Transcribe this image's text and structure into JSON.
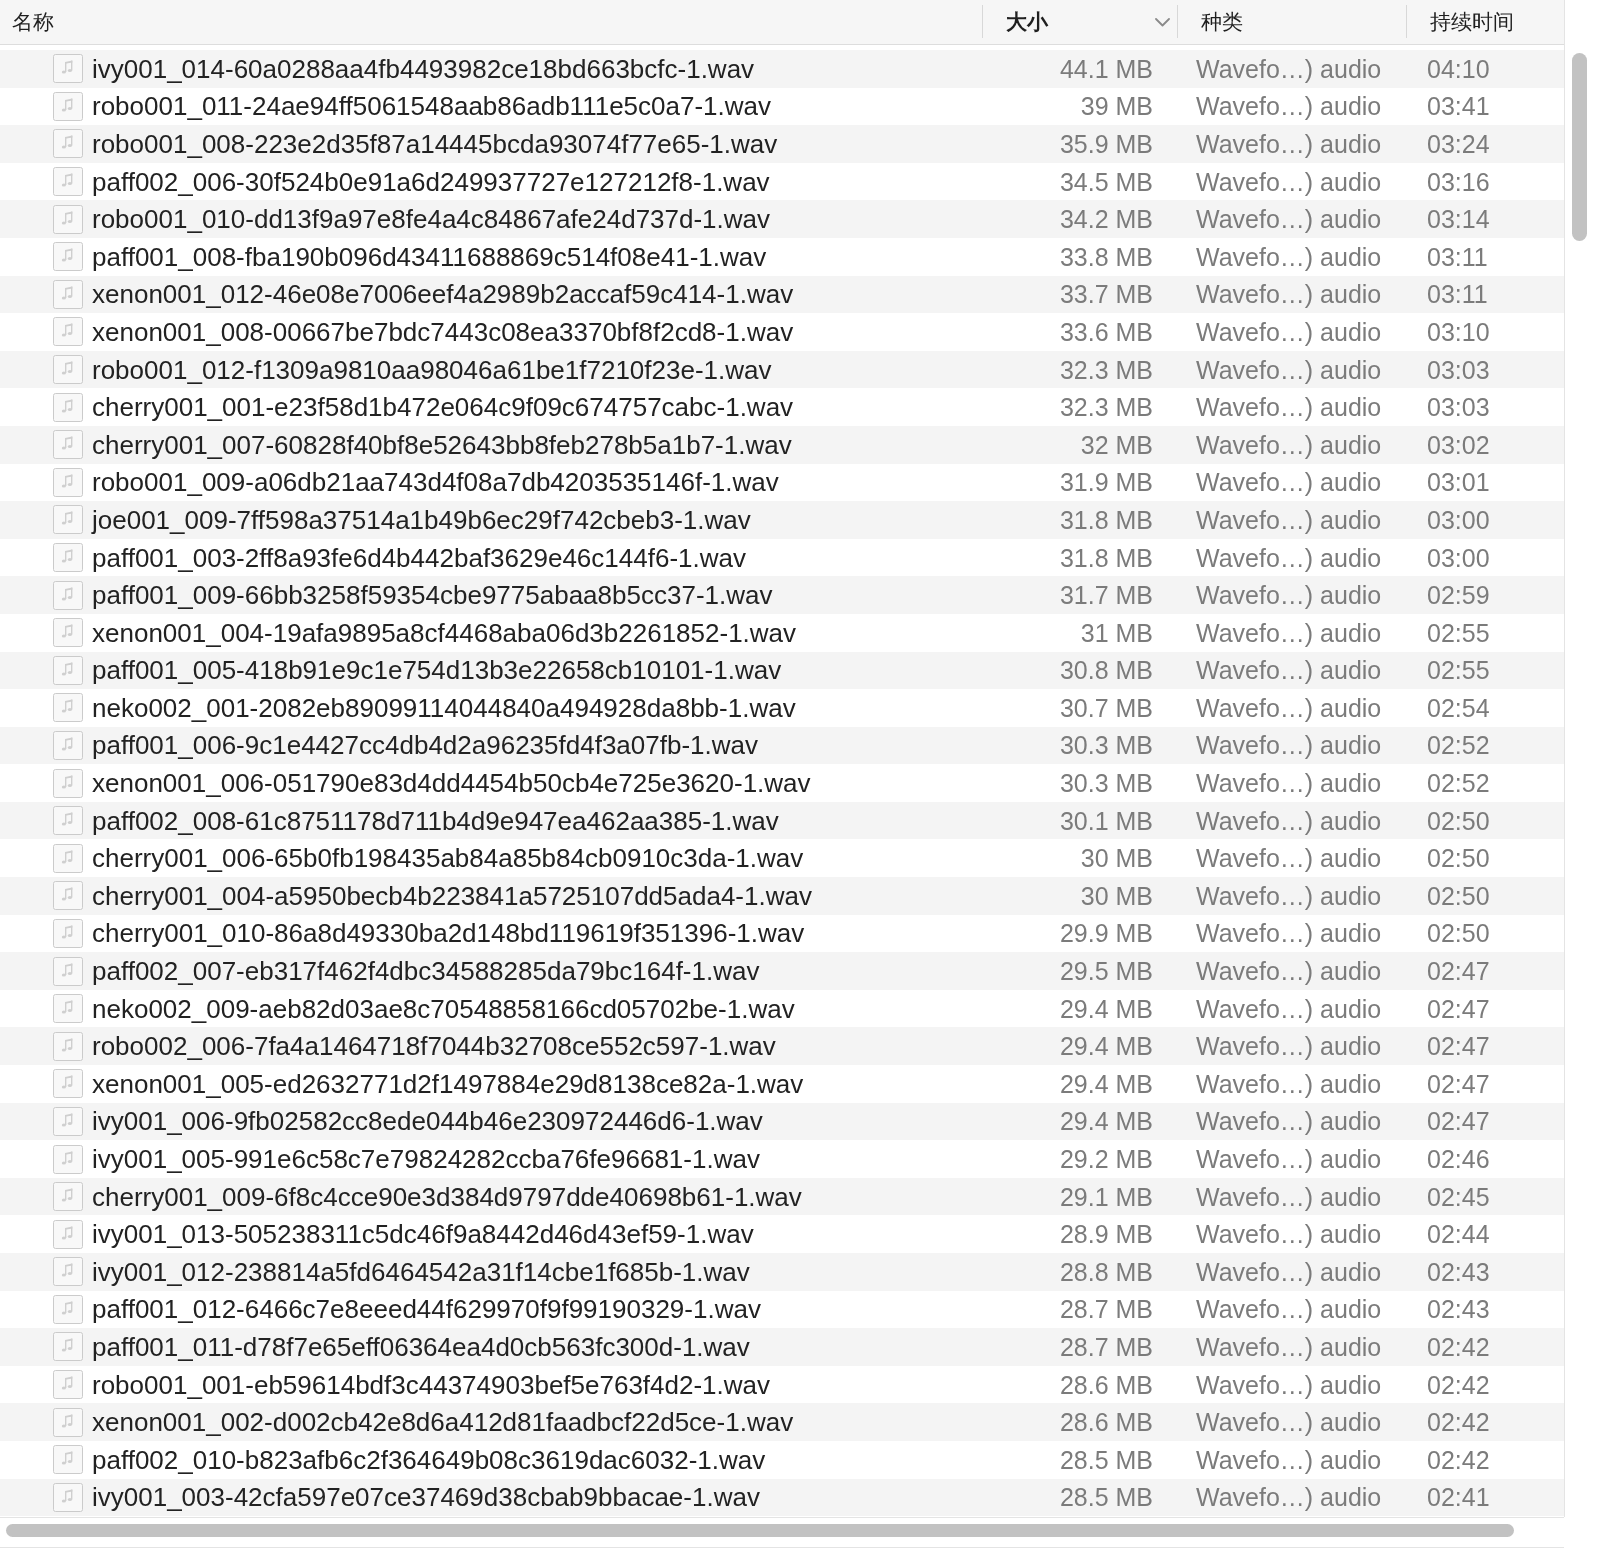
{
  "columns": [
    {
      "label": "名称",
      "sorted": false
    },
    {
      "label": "大小",
      "sorted": true
    },
    {
      "label": "种类",
      "sorted": false
    },
    {
      "label": "持续时间",
      "sorted": false
    }
  ],
  "rows": [
    {
      "name": "ivy001_014-60a0288aa4fb4493982ce18bd663bcfc-1.wav",
      "size": "44.1 MB",
      "file_kind": "Wavefo…) audio",
      "duration": "04:10",
      "selected": false
    },
    {
      "name": "robo001_011-24ae94ff5061548aab86adb111e5c0a7-1.wav",
      "size": "39 MB",
      "file_kind": "Wavefo…) audio",
      "duration": "03:41",
      "selected": false
    },
    {
      "name": "robo001_008-223e2d35f87a14445bcda93074f77e65-1.wav",
      "size": "35.9 MB",
      "file_kind": "Wavefo…) audio",
      "duration": "03:24",
      "selected": false
    },
    {
      "name": "paff002_006-30f524b0e91a6d249937727e127212f8-1.wav",
      "size": "34.5 MB",
      "file_kind": "Wavefo…) audio",
      "duration": "03:16",
      "selected": false
    },
    {
      "name": "robo001_010-dd13f9a97e8fe4a4c84867afe24d737d-1.wav",
      "size": "34.2 MB",
      "file_kind": "Wavefo…) audio",
      "duration": "03:14",
      "selected": false
    },
    {
      "name": "paff001_008-fba190b096d43411688869c514f08e41-1.wav",
      "size": "33.8 MB",
      "file_kind": "Wavefo…) audio",
      "duration": "03:11",
      "selected": false
    },
    {
      "name": "xenon001_012-46e08e7006eef4a2989b2accaf59c414-1.wav",
      "size": "33.7 MB",
      "file_kind": "Wavefo…) audio",
      "duration": "03:11",
      "selected": false
    },
    {
      "name": "xenon001_008-00667be7bdc7443c08ea3370bf8f2cd8-1.wav",
      "size": "33.6 MB",
      "file_kind": "Wavefo…) audio",
      "duration": "03:10",
      "selected": false
    },
    {
      "name": "robo001_012-f1309a9810aa98046a61be1f7210f23e-1.wav",
      "size": "32.3 MB",
      "file_kind": "Wavefo…) audio",
      "duration": "03:03",
      "selected": false
    },
    {
      "name": "cherry001_001-e23f58d1b472e064c9f09c674757cabc-1.wav",
      "size": "32.3 MB",
      "file_kind": "Wavefo…) audio",
      "duration": "03:03",
      "selected": false
    },
    {
      "name": "cherry001_007-60828f40bf8e52643bb8feb278b5a1b7-1.wav",
      "size": "32 MB",
      "file_kind": "Wavefo…) audio",
      "duration": "03:02",
      "selected": false
    },
    {
      "name": "robo001_009-a06db21aa743d4f08a7db4203535146f-1.wav",
      "size": "31.9 MB",
      "file_kind": "Wavefo…) audio",
      "duration": "03:01",
      "selected": false
    },
    {
      "name": "joe001_009-7ff598a37514a1b49b6ec29f742cbeb3-1.wav",
      "size": "31.8 MB",
      "file_kind": "Wavefo…) audio",
      "duration": "03:00",
      "selected": false
    },
    {
      "name": "paff001_003-2ff8a93fe6d4b442baf3629e46c144f6-1.wav",
      "size": "31.8 MB",
      "file_kind": "Wavefo…) audio",
      "duration": "03:00",
      "selected": false
    },
    {
      "name": "paff001_009-66bb3258f59354cbe9775abaa8b5cc37-1.wav",
      "size": "31.7 MB",
      "file_kind": "Wavefo…) audio",
      "duration": "02:59",
      "selected": false
    },
    {
      "name": "xenon001_004-19afa9895a8cf4468aba06d3b2261852-1.wav",
      "size": "31 MB",
      "file_kind": "Wavefo…) audio",
      "duration": "02:55",
      "selected": false
    },
    {
      "name": "paff001_005-418b91e9c1e754d13b3e22658cb10101-1.wav",
      "size": "30.8 MB",
      "file_kind": "Wavefo…) audio",
      "duration": "02:55",
      "selected": false
    },
    {
      "name": "neko002_001-2082eb89099114044840a494928da8bb-1.wav",
      "size": "30.7 MB",
      "file_kind": "Wavefo…) audio",
      "duration": "02:54",
      "selected": false
    },
    {
      "name": "paff001_006-9c1e4427cc4db4d2a96235fd4f3a07fb-1.wav",
      "size": "30.3 MB",
      "file_kind": "Wavefo…) audio",
      "duration": "02:52",
      "selected": false
    },
    {
      "name": "xenon001_006-051790e83d4dd4454b50cb4e725e3620-1.wav",
      "size": "30.3 MB",
      "file_kind": "Wavefo…) audio",
      "duration": "02:52",
      "selected": false
    },
    {
      "name": "paff002_008-61c8751178d711b4d9e947ea462aa385-1.wav",
      "size": "30.1 MB",
      "file_kind": "Wavefo…) audio",
      "duration": "02:50",
      "selected": false
    },
    {
      "name": "cherry001_006-65b0fb198435ab84a85b84cb0910c3da-1.wav",
      "size": "30 MB",
      "file_kind": "Wavefo…) audio",
      "duration": "02:50",
      "selected": false
    },
    {
      "name": "cherry001_004-a5950becb4b223841a5725107dd5ada4-1.wav",
      "size": "30 MB",
      "file_kind": "Wavefo…) audio",
      "duration": "02:50",
      "selected": false
    },
    {
      "name": "cherry001_010-86a8d49330ba2d148bd119619f351396-1.wav",
      "size": "29.9 MB",
      "file_kind": "Wavefo…) audio",
      "duration": "02:50",
      "selected": false
    },
    {
      "name": "paff002_007-eb317f462f4dbc34588285da79bc164f-1.wav",
      "size": "29.5 MB",
      "file_kind": "Wavefo…) audio",
      "duration": "02:47",
      "selected": false
    },
    {
      "name": "neko002_009-aeb82d03ae8c70548858166cd05702be-1.wav",
      "size": "29.4 MB",
      "file_kind": "Wavefo…) audio",
      "duration": "02:47",
      "selected": false
    },
    {
      "name": "robo002_006-7fa4a1464718f7044b32708ce552c597-1.wav",
      "size": "29.4 MB",
      "file_kind": "Wavefo…) audio",
      "duration": "02:47",
      "selected": false
    },
    {
      "name": "xenon001_005-ed2632771d2f1497884e29d8138ce82a-1.wav",
      "size": "29.4 MB",
      "file_kind": "Wavefo…) audio",
      "duration": "02:47",
      "selected": false
    },
    {
      "name": "ivy001_006-9fb02582cc8ede044b46e230972446d6-1.wav",
      "size": "29.4 MB",
      "file_kind": "Wavefo…) audio",
      "duration": "02:47",
      "selected": false
    },
    {
      "name": "ivy001_005-991e6c58c7e79824282ccba76fe96681-1.wav",
      "size": "29.2 MB",
      "file_kind": "Wavefo…) audio",
      "duration": "02:46",
      "selected": false
    },
    {
      "name": "cherry001_009-6f8c4cce90e3d384d9797dde40698b61-1.wav",
      "size": "29.1 MB",
      "file_kind": "Wavefo…) audio",
      "duration": "02:45",
      "selected": false
    },
    {
      "name": "ivy001_013-505238311c5dc46f9a8442d46d43ef59-1.wav",
      "size": "28.9 MB",
      "file_kind": "Wavefo…) audio",
      "duration": "02:44",
      "selected": false
    },
    {
      "name": "ivy001_012-238814a5fd6464542a31f14cbe1f685b-1.wav",
      "size": "28.8 MB",
      "file_kind": "Wavefo…) audio",
      "duration": "02:43",
      "selected": false
    },
    {
      "name": "paff001_012-6466c7e8eeed44f629970f9f99190329-1.wav",
      "size": "28.7 MB",
      "file_kind": "Wavefo…) audio",
      "duration": "02:43",
      "selected": false
    },
    {
      "name": "paff001_011-d78f7e65eff06364ea4d0cb563fc300d-1.wav",
      "size": "28.7 MB",
      "file_kind": "Wavefo…) audio",
      "duration": "02:42",
      "selected": false
    },
    {
      "name": "robo001_001-eb59614bdf3c44374903bef5e763f4d2-1.wav",
      "size": "28.6 MB",
      "file_kind": "Wavefo…) audio",
      "duration": "02:42",
      "selected": false
    },
    {
      "name": "xenon001_002-d002cb42e8d6a412d81faadbcf22d5ce-1.wav",
      "size": "28.6 MB",
      "file_kind": "Wavefo…) audio",
      "duration": "02:42",
      "selected": false
    },
    {
      "name": "paff002_010-b823afb6c2f364649b08c3619dac6032-1.wav",
      "size": "28.5 MB",
      "file_kind": "Wavefo…) audio",
      "duration": "02:42",
      "selected": false
    },
    {
      "name": "ivy001_003-42cfa597e07ce37469d38cbab9bbacae-1.wav",
      "size": "28.5 MB",
      "file_kind": "Wavefo…) audio",
      "duration": "02:41",
      "selected": false
    }
  ]
}
